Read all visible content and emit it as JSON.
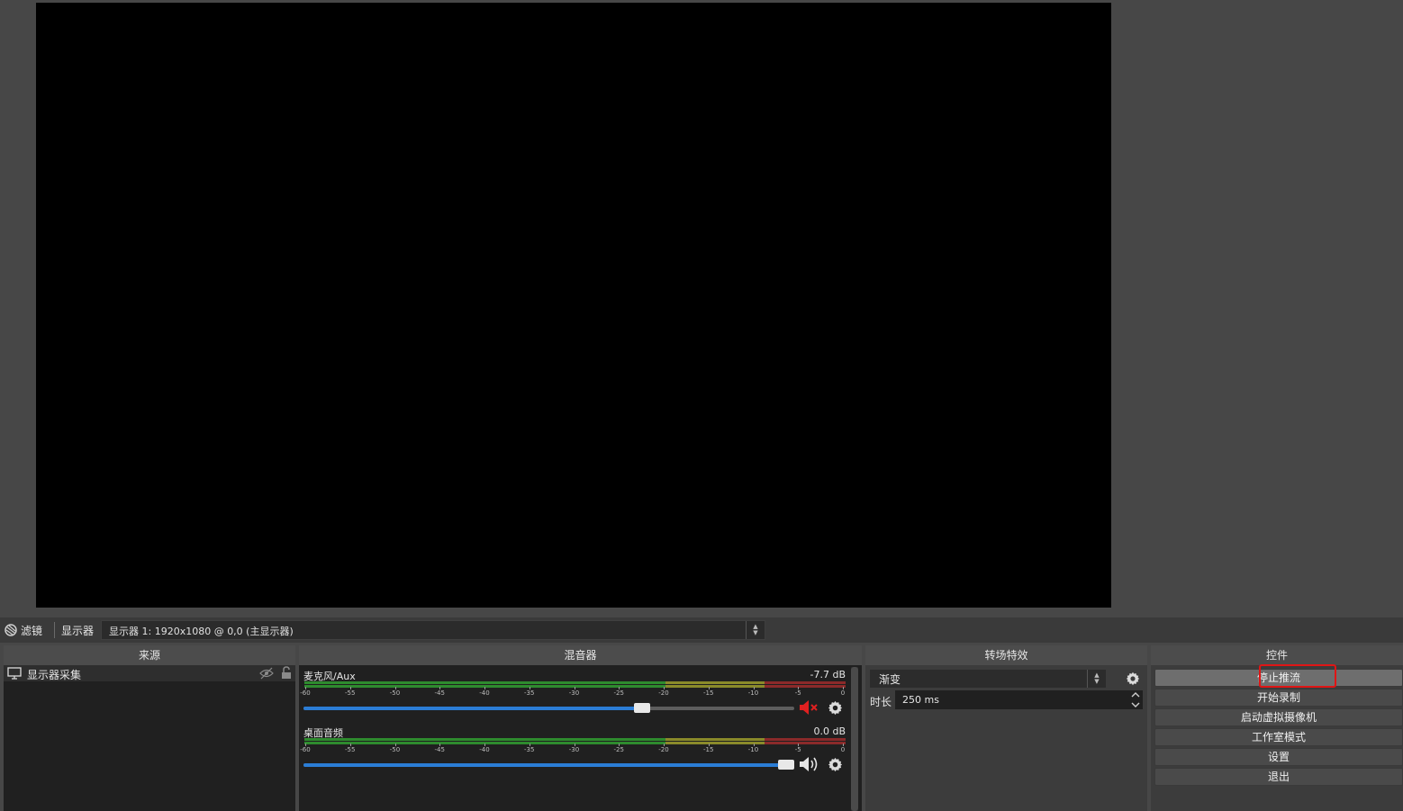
{
  "source_toolbar": {
    "filters_label": "滤镜",
    "display_label": "显示器",
    "display_select_value": "显示器 1: 1920x1080 @ 0,0 (主显示器)"
  },
  "sources": {
    "title": "来源",
    "items": [
      {
        "label": "显示器采集",
        "icon": "monitor-icon"
      }
    ]
  },
  "mixer": {
    "title": "混音器",
    "tick_labels": [
      "-60",
      "-55",
      "-50",
      "-45",
      "-40",
      "-35",
      "-30",
      "-25",
      "-20",
      "-15",
      "-10",
      "-5",
      "0"
    ],
    "channels": [
      {
        "name": "麦克风/Aux",
        "level_db": "-7.7 dB",
        "volume_fraction": 0.69,
        "muted": true,
        "speaker_icon": "speaker-muted-icon"
      },
      {
        "name": "桌面音频",
        "level_db": "0.0 dB",
        "volume_fraction": 1.0,
        "muted": false,
        "speaker_icon": "speaker-icon"
      }
    ],
    "colors": {
      "green": "#2e8b2e",
      "yellow": "#8a8a2a",
      "red": "#8b2a2a",
      "fader": "#2b7dd6",
      "mute": "#e02020"
    }
  },
  "transitions": {
    "title": "转场特效",
    "selected": "渐变",
    "duration_label": "时长",
    "duration_value": "250 ms"
  },
  "controls": {
    "title": "控件",
    "buttons": [
      "停止推流",
      "开始录制",
      "启动虚拟摄像机",
      "工作室模式",
      "设置",
      "退出"
    ],
    "highlight_color": "#e01515"
  }
}
